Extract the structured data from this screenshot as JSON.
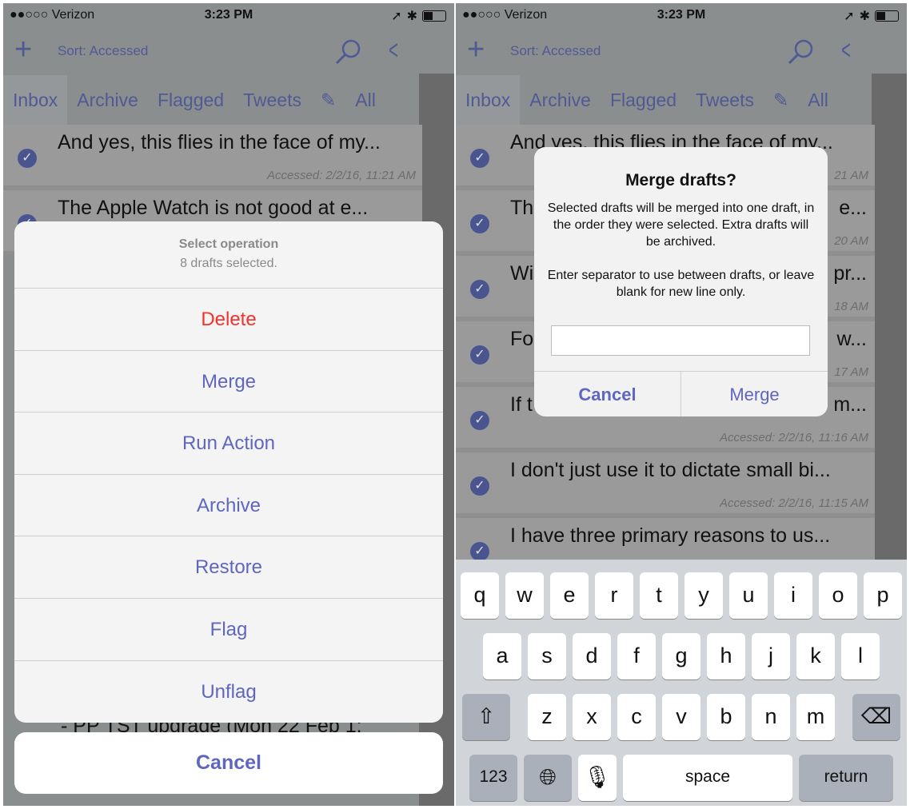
{
  "status": {
    "carrier": "●●○○○ Verizon",
    "time": "3:23 PM"
  },
  "nav": {
    "sort": "Sort: Accessed"
  },
  "tabs": [
    "Inbox",
    "Archive",
    "Flagged",
    "Tweets",
    "All"
  ],
  "left": {
    "rows": [
      {
        "title": "And yes, this flies in the face of my...",
        "ts": "Accessed: 2/2/16, 11:21 AM"
      },
      {
        "title": "The Apple Watch is not good at e...",
        "ts": ""
      }
    ],
    "behind_text": "- PP TST upgrade (Mon 22 Feb 1:",
    "sheet": {
      "title": "Select operation",
      "subtitle": "8 drafts selected.",
      "items": [
        "Delete",
        "Merge",
        "Run Action",
        "Archive",
        "Restore",
        "Flag",
        "Unflag"
      ],
      "cancel": "Cancel"
    }
  },
  "right": {
    "rows": [
      {
        "left": "And yes, this flies in the face of my...",
        "right": "",
        "ts": "21 AM"
      },
      {
        "left": "Th",
        "right": "e...",
        "ts": "20 AM"
      },
      {
        "left": "Wi",
        "right": "pr...",
        "ts": "18 AM"
      },
      {
        "left": "Fo",
        "right": "w...",
        "ts": "17 AM"
      },
      {
        "left": "If t",
        "right": "m...",
        "ts": "Accessed: 2/2/16, 11:16 AM"
      },
      {
        "left": "I don't just use it to dictate small bi...",
        "right": "",
        "ts": "Accessed: 2/2/16, 11:15 AM"
      },
      {
        "left": "I have three primary reasons to us...",
        "right": "",
        "ts": ""
      }
    ],
    "alert": {
      "title": "Merge drafts?",
      "message": "Selected drafts will be merged into one draft, in the order they were selected. Extra drafts will be archived.\n\nEnter separator to use between drafts, or leave blank for new line only.",
      "input_value": "",
      "cancel": "Cancel",
      "confirm": "Merge"
    },
    "keyboard": {
      "row1": [
        "q",
        "w",
        "e",
        "r",
        "t",
        "y",
        "u",
        "i",
        "o",
        "p"
      ],
      "row2": [
        "a",
        "s",
        "d",
        "f",
        "g",
        "h",
        "j",
        "k",
        "l"
      ],
      "row3": [
        "z",
        "x",
        "c",
        "v",
        "b",
        "n",
        "m"
      ],
      "numbers": "123",
      "space": "space",
      "return": "return"
    }
  },
  "colors": {
    "accent": "#5e66c0",
    "destructive": "#f5312c"
  }
}
